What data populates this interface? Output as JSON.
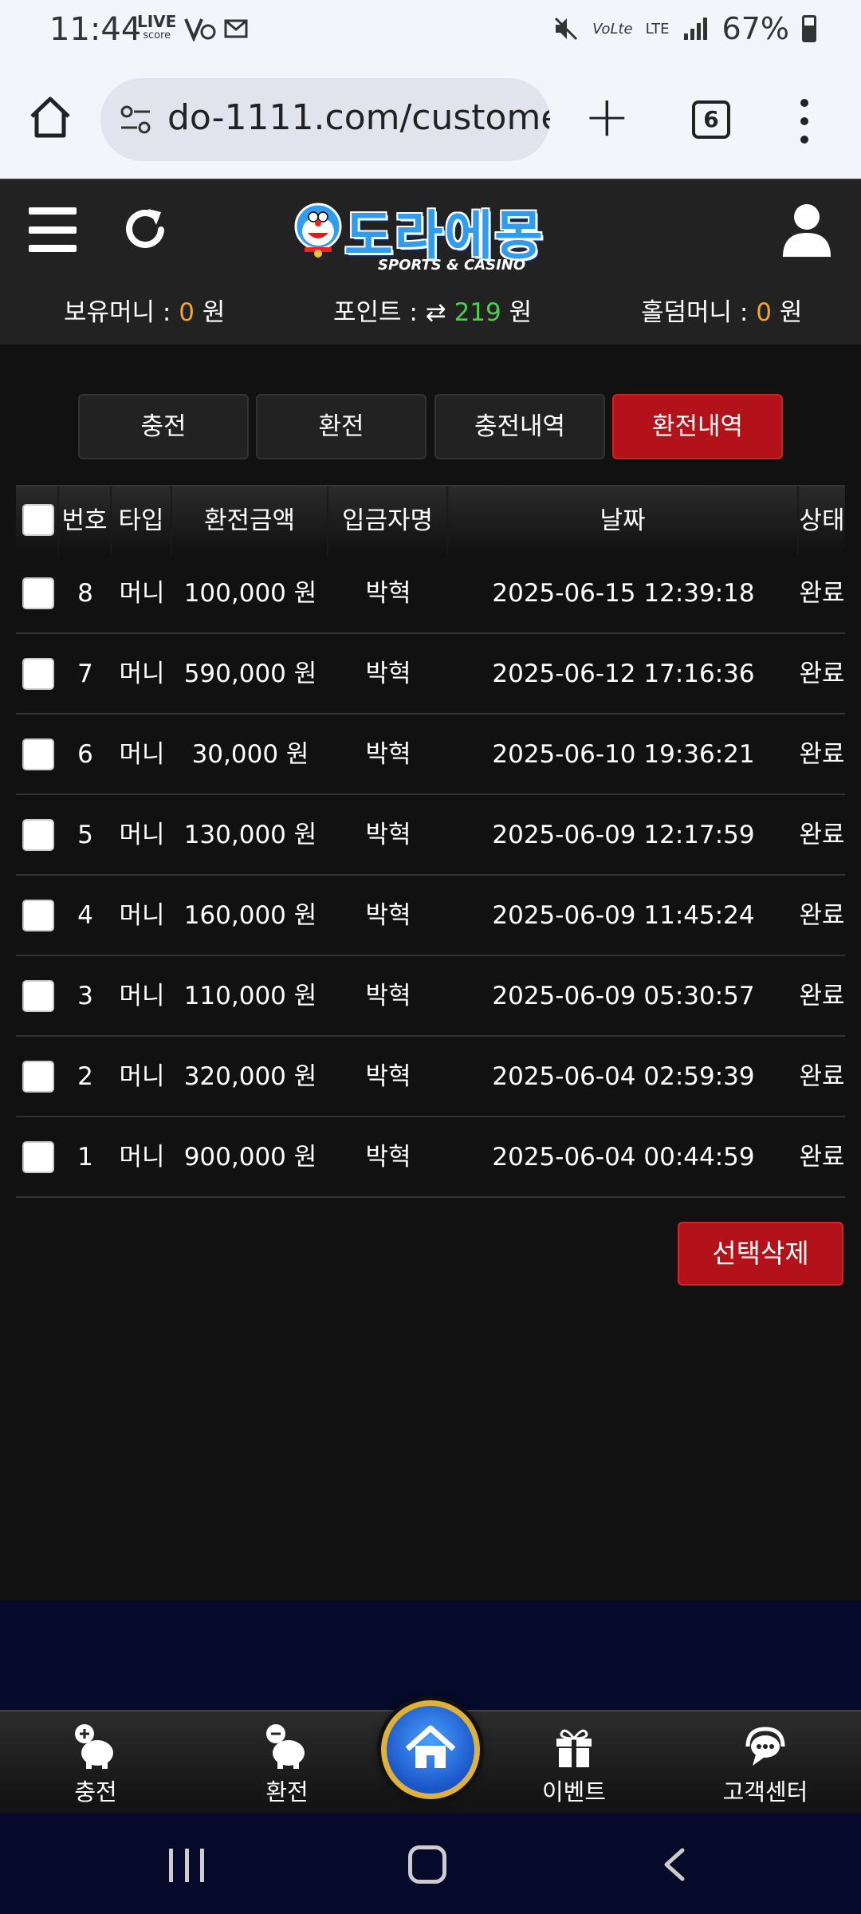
{
  "status_bar": {
    "time": "11:44",
    "live_label": "LIVE",
    "live_sub": "score",
    "battery": "67%",
    "lte_label": "LTE",
    "volte_label": "VoLte"
  },
  "browser": {
    "url": "do-1111.com/customer",
    "tab_count": "6"
  },
  "header": {
    "logo_title": "도라에몽",
    "logo_subtitle": "SPORTS & CASINO",
    "money_label": "보유머니 :",
    "money_value": "0",
    "money_unit": "원",
    "point_label": "포인트 :",
    "point_value": "219",
    "point_unit": "원",
    "holdem_label": "홀덤머니 :",
    "holdem_value": "0",
    "holdem_unit": "원"
  },
  "tabs": [
    {
      "label": "충전",
      "active": false
    },
    {
      "label": "환전",
      "active": false
    },
    {
      "label": "충전내역",
      "active": false
    },
    {
      "label": "환전내역",
      "active": true
    }
  ],
  "table": {
    "headers": [
      "번호",
      "타입",
      "환전금액",
      "입금자명",
      "날짜",
      "상태"
    ],
    "rows": [
      {
        "no": "8",
        "type": "머니",
        "amount": "100,000 원",
        "name": "박혁",
        "date": "2025-06-15 12:39:18",
        "status": "완료"
      },
      {
        "no": "7",
        "type": "머니",
        "amount": "590,000 원",
        "name": "박혁",
        "date": "2025-06-12 17:16:36",
        "status": "완료"
      },
      {
        "no": "6",
        "type": "머니",
        "amount": "30,000 원",
        "name": "박혁",
        "date": "2025-06-10 19:36:21",
        "status": "완료"
      },
      {
        "no": "5",
        "type": "머니",
        "amount": "130,000 원",
        "name": "박혁",
        "date": "2025-06-09 12:17:59",
        "status": "완료"
      },
      {
        "no": "4",
        "type": "머니",
        "amount": "160,000 원",
        "name": "박혁",
        "date": "2025-06-09 11:45:24",
        "status": "완료"
      },
      {
        "no": "3",
        "type": "머니",
        "amount": "110,000 원",
        "name": "박혁",
        "date": "2025-06-09 05:30:57",
        "status": "완료"
      },
      {
        "no": "2",
        "type": "머니",
        "amount": "320,000 원",
        "name": "박혁",
        "date": "2025-06-04 02:59:39",
        "status": "완료"
      },
      {
        "no": "1",
        "type": "머니",
        "amount": "900,000 원",
        "name": "박혁",
        "date": "2025-06-04 00:44:59",
        "status": "완료"
      }
    ]
  },
  "delete_button": "선택삭제",
  "bottom_nav": {
    "charge": "충전",
    "exchange": "환전",
    "event": "이벤트",
    "support": "고객센터"
  },
  "colors": {
    "accent_red": "#b3121a",
    "orange": "#f3a52c",
    "green": "#4cd14c",
    "background": "#111111"
  }
}
